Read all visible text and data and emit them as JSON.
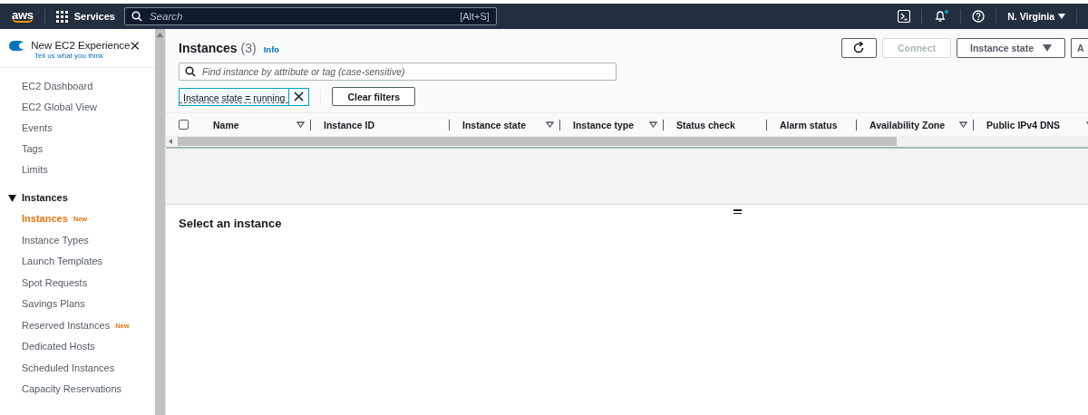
{
  "top_bar": {
    "logo": "aws",
    "services": "Services",
    "search": {
      "placeholder": "Search",
      "shortcut": "[Alt+S]"
    },
    "notifications_unread": true,
    "region": "N. Virginia"
  },
  "sidebar": {
    "experience": {
      "label": "New EC2 Experience",
      "link": "Tell us what you think",
      "on": true
    },
    "items": [
      {
        "label": "EC2 Dashboard",
        "selected": false
      },
      {
        "label": "EC2 Global View",
        "selected": false
      },
      {
        "label": "Events",
        "selected": false
      },
      {
        "label": "Tags",
        "selected": false
      },
      {
        "label": "Limits",
        "selected": false
      }
    ],
    "sections": [
      {
        "label": "Instances",
        "expanded": true,
        "children": [
          {
            "label": "Instances",
            "selected": true,
            "badge": "New"
          },
          {
            "label": "Instance Types",
            "selected": false
          },
          {
            "label": "Launch Templates",
            "selected": false
          },
          {
            "label": "Spot Requests",
            "selected": false
          },
          {
            "label": "Savings Plans",
            "selected": false
          },
          {
            "label": "Reserved Instances",
            "selected": false,
            "badge": "New"
          },
          {
            "label": "Dedicated Hosts",
            "selected": false
          },
          {
            "label": "Scheduled Instances",
            "selected": false
          },
          {
            "label": "Capacity Reservations",
            "selected": false
          }
        ]
      }
    ]
  },
  "main": {
    "title": "Instances",
    "count": "(3)",
    "info": "Info",
    "actions": [
      {
        "kind": "refresh",
        "disabled": false
      },
      {
        "kind": "text",
        "label": "Connect",
        "disabled": true
      },
      {
        "kind": "dropdown",
        "label": "Instance state",
        "disabled": false
      },
      {
        "kind": "text",
        "label": "A",
        "disabled": false
      }
    ],
    "filter": {
      "placeholder": "Find instance by attribute or tag (case-sensitive)"
    },
    "tokens": [
      "Instance state = running"
    ],
    "clear": "Clear filters",
    "table": {
      "all_checked": false,
      "columns": [
        {
          "label": "Name",
          "sortable": true
        },
        {
          "label": "Instance ID",
          "sortable": false
        },
        {
          "label": "Instance state",
          "sortable": true
        },
        {
          "label": "Instance type",
          "sortable": true
        },
        {
          "label": "Status check",
          "sortable": false
        },
        {
          "label": "Alarm status",
          "sortable": false
        },
        {
          "label": "Availability Zone",
          "sortable": true
        },
        {
          "label": "Public IPv4 DNS",
          "sortable": true
        }
      ]
    },
    "details": {
      "title": "Select an instance"
    }
  }
}
